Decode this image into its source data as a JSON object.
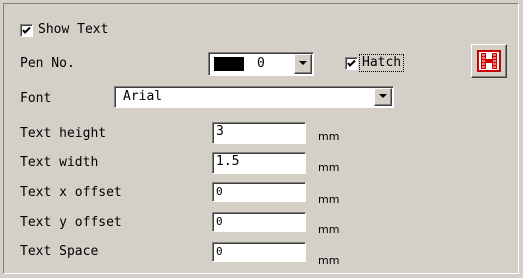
{
  "show_text": {
    "label": "Show Text",
    "checked": true
  },
  "pen": {
    "label": "Pen No.",
    "value": "0",
    "swatch_color": "#000000"
  },
  "hatch": {
    "label": "Hatch",
    "checked": true,
    "icon": "hatch-h-icon",
    "icon_color": "#cc0000"
  },
  "font": {
    "label": "Font",
    "value": "Arial"
  },
  "fields": [
    {
      "label": "Text height",
      "value": "3",
      "unit": "mm"
    },
    {
      "label": "Text width",
      "value": "1.5",
      "unit": "mm"
    },
    {
      "label": "Text x offset",
      "value": "0",
      "unit": "mm"
    },
    {
      "label": "Text y offset",
      "value": "0",
      "unit": "mm"
    },
    {
      "label": "Text Space",
      "value": "0",
      "unit": "mm"
    }
  ]
}
